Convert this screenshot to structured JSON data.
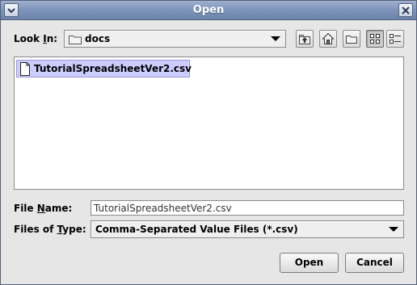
{
  "window": {
    "title": "Open",
    "menu_icon": "chevron-down-icon",
    "close_icon": "close-x-icon"
  },
  "look_in": {
    "label_prefix": "Look ",
    "label_mnemonic": "I",
    "label_suffix": "n:",
    "value": "docs",
    "folder_icon": "folder-icon"
  },
  "toolbar": {
    "buttons": [
      {
        "name": "up-one-level-icon",
        "tooltip_hidden": true
      },
      {
        "name": "home-icon"
      },
      {
        "name": "new-folder-icon"
      },
      {
        "name": "list-view-icon",
        "pressed": true
      },
      {
        "name": "details-view-icon"
      }
    ]
  },
  "files": [
    {
      "name": "TutorialSpreadsheetVer2.csv",
      "selected": true,
      "icon": "file-icon"
    }
  ],
  "file_name": {
    "label_prefix": "File ",
    "label_mnemonic": "N",
    "label_suffix": "ame:",
    "value": "TutorialSpreadsheetVer2.csv"
  },
  "files_of_type": {
    "label_prefix": "Files of ",
    "label_mnemonic": "T",
    "label_suffix": "ype:",
    "value": "Comma-Separated Value Files (*.csv)"
  },
  "buttons": {
    "open": "Open",
    "cancel": "Cancel"
  },
  "colors": {
    "selection": "#ccccff",
    "titlebar": "#7f95bb",
    "background": "#e6e6e6"
  }
}
